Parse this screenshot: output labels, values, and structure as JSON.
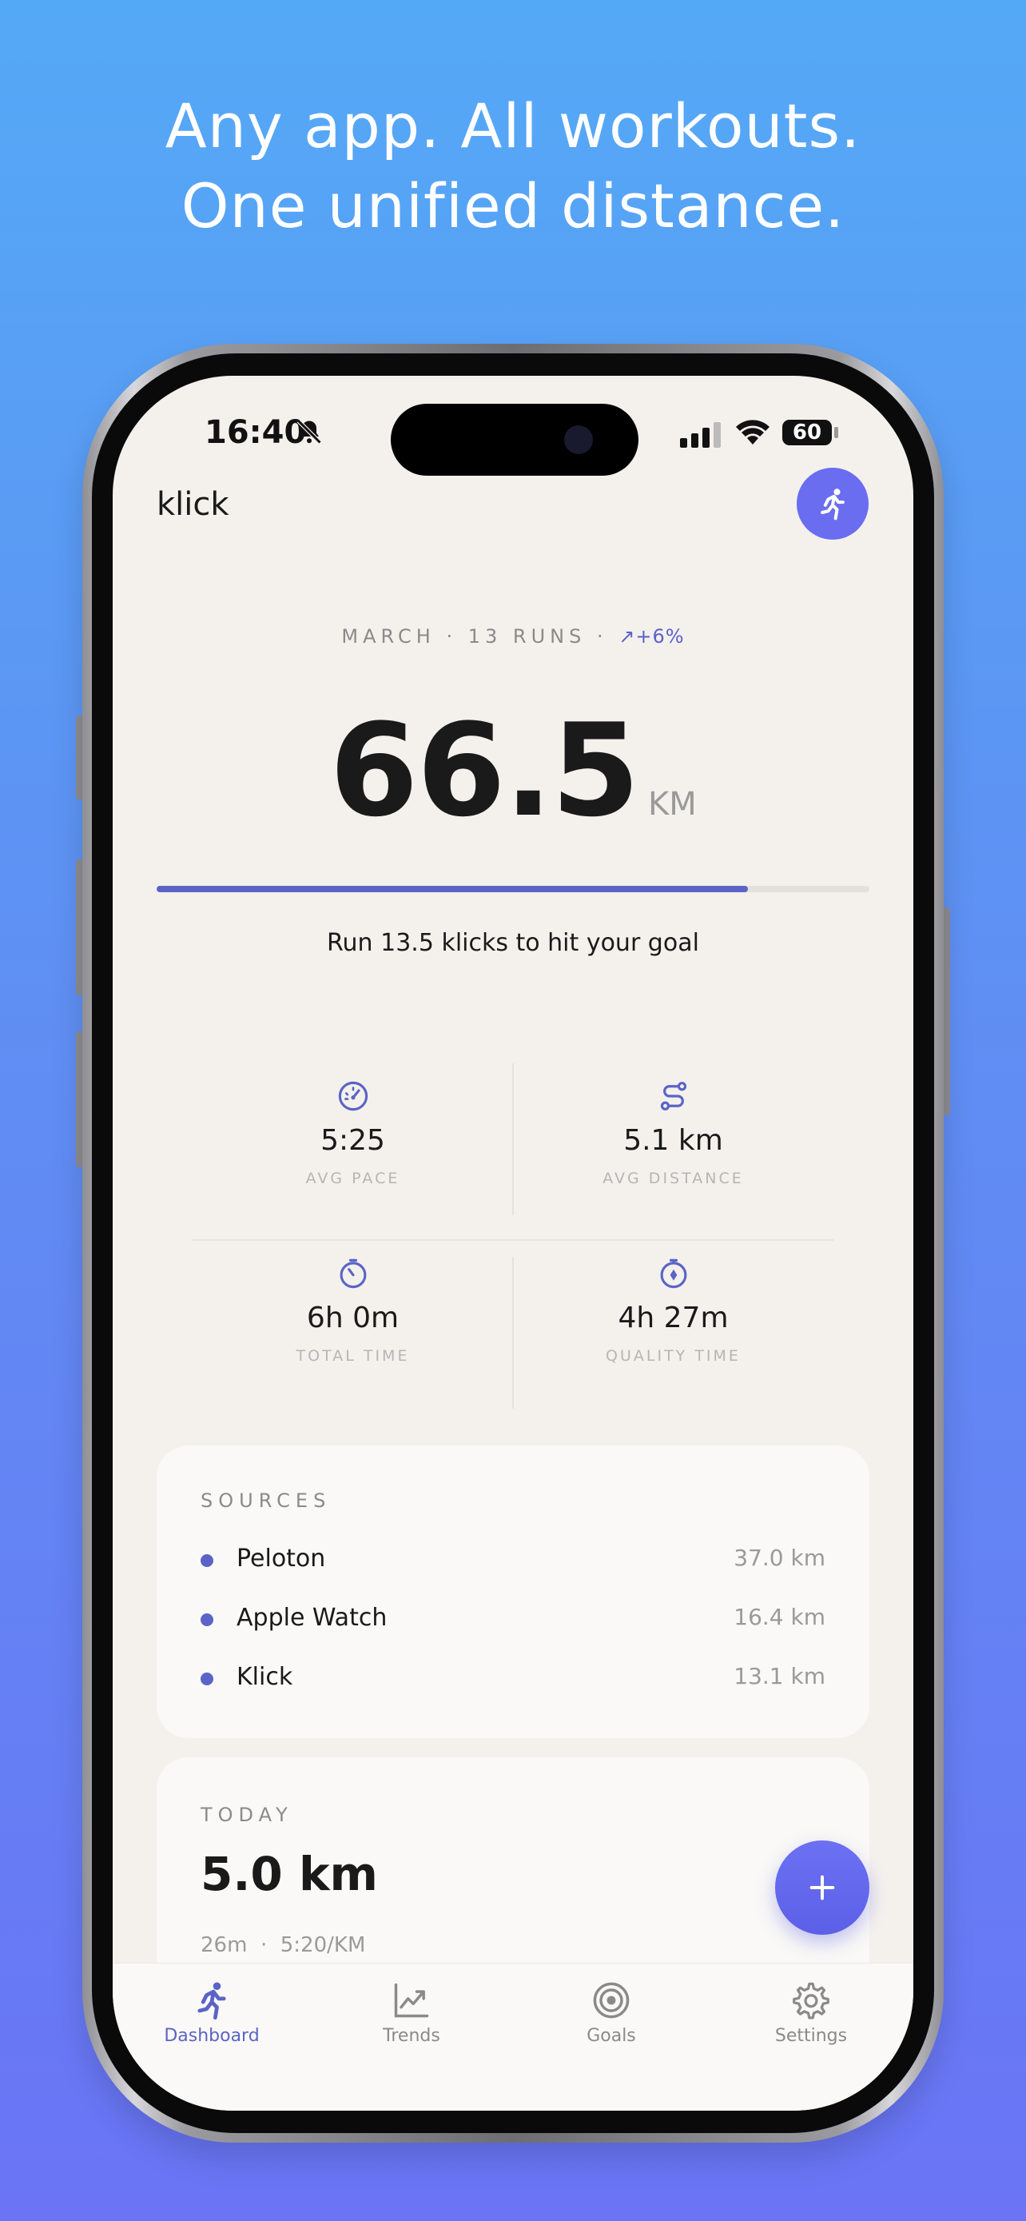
{
  "headline": {
    "line1": "Any app. All workouts.",
    "line2": "One unified distance."
  },
  "status_bar": {
    "time": "16:40",
    "battery": "60"
  },
  "app": {
    "title": "klick"
  },
  "summary": {
    "month": "MARCH",
    "separator": "·",
    "runs": "13 RUNS",
    "trend_arrow": "↗",
    "trend": "+6%",
    "distance": "66.5",
    "unit": "KM",
    "goal_progress_fraction": 0.83,
    "goal_text": "Run 13.5 klicks to hit your goal"
  },
  "stats": [
    {
      "icon": "speedometer-icon",
      "value": "5:25",
      "label": "AVG PACE"
    },
    {
      "icon": "route-icon",
      "value": "5.1 km",
      "label": "AVG DISTANCE"
    },
    {
      "icon": "timer-icon",
      "value": "6h 0m",
      "label": "TOTAL TIME"
    },
    {
      "icon": "stopwatch-icon",
      "value": "4h 27m",
      "label": "QUALITY TIME"
    }
  ],
  "sources": {
    "title": "SOURCES",
    "items": [
      {
        "name": "Peloton",
        "distance": "37.0 km"
      },
      {
        "name": "Apple Watch",
        "distance": "16.4 km"
      },
      {
        "name": "Klick",
        "distance": "13.1 km"
      }
    ]
  },
  "today": {
    "title": "TODAY",
    "distance": "5.0 km",
    "duration": "26m",
    "separator": "·",
    "pace": "5:20/KM"
  },
  "tabs": [
    {
      "label": "Dashboard",
      "icon": "runner-icon",
      "active": true
    },
    {
      "label": "Trends",
      "icon": "chart-line-icon",
      "active": false
    },
    {
      "label": "Goals",
      "icon": "target-icon",
      "active": false
    },
    {
      "label": "Settings",
      "icon": "gear-icon",
      "active": false
    }
  ],
  "colors": {
    "accent": "#5b64c6",
    "background_top": "#54a9f6",
    "background_bottom": "#6a74f5",
    "screen_bg": "#f4f1ed"
  }
}
